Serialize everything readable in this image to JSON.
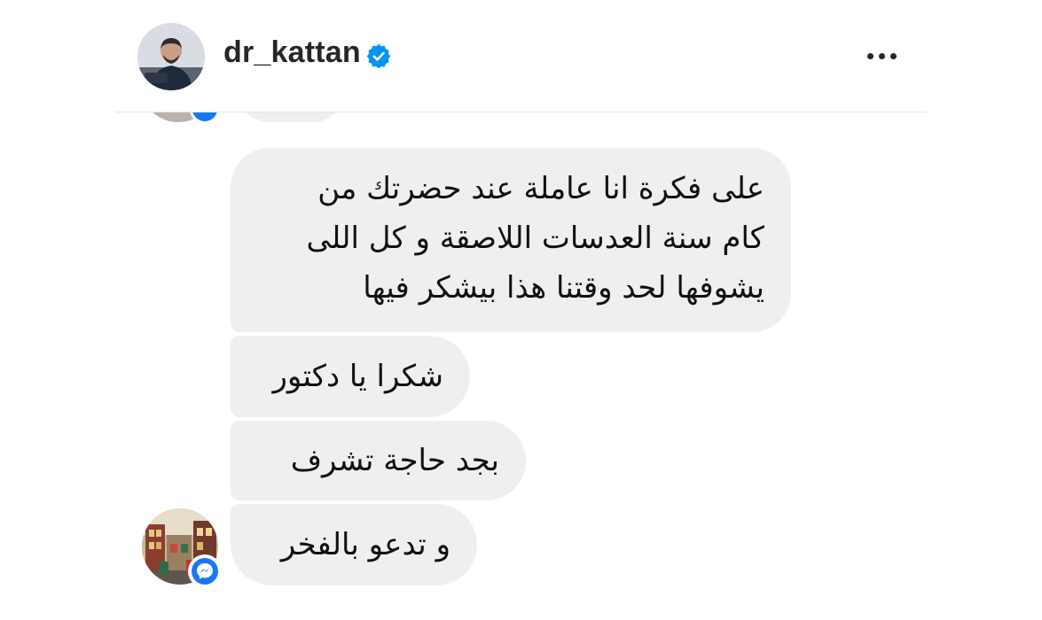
{
  "header": {
    "username": "dr_kattan",
    "verified_icon": "verified-badge-icon",
    "more_icon": "more-horizontal-icon",
    "accent_color": "#0095f6"
  },
  "messages": [
    {
      "text": "على فكرة انا عاملة عند حضرتك من\nكام سنة العدسات اللاصقة و كل اللى\nيشوفها لحد وقتنا هذا بيشكر فيها"
    },
    {
      "text": "شكرا يا دكتور"
    },
    {
      "text": "بجد حاجة تشرف"
    },
    {
      "text": "و تدعو بالفخر"
    }
  ],
  "sender": {
    "badge_icon": "messenger-icon",
    "badge_color": "#1877f2"
  },
  "colors": {
    "bubble_bg": "#efefef",
    "text": "#111111",
    "header_text": "#262626",
    "divider": "#e6e6e6"
  }
}
